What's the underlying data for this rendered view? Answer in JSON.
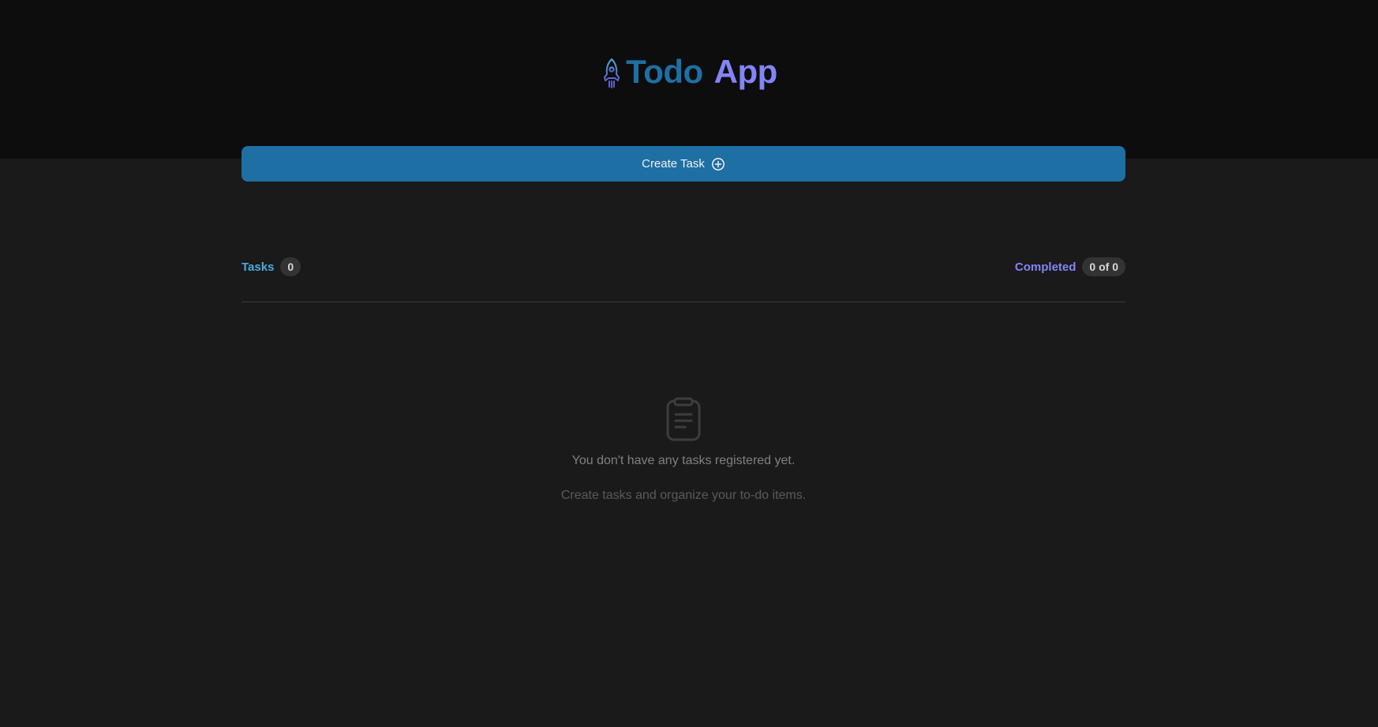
{
  "header": {
    "title_part1": "Todo",
    "title_part2": "App",
    "logo_icon": "rocket-icon"
  },
  "actions": {
    "create_label": "Create Task",
    "create_icon": "plus-circle-icon"
  },
  "counters": {
    "tasks_label": "Tasks",
    "tasks_count": "0",
    "completed_label": "Completed",
    "completed_count": "0 of 0"
  },
  "empty_state": {
    "icon": "clipboard-icon",
    "message": "You don't have any tasks registered yet.",
    "hint": "Create tasks and organize your to-do items."
  },
  "colors": {
    "header_bg": "#0d0d0d",
    "page_bg": "#1a1a1a",
    "primary": "#1e6fa3",
    "accent_blue": "#4ea8de",
    "accent_purple": "#8484f7"
  }
}
